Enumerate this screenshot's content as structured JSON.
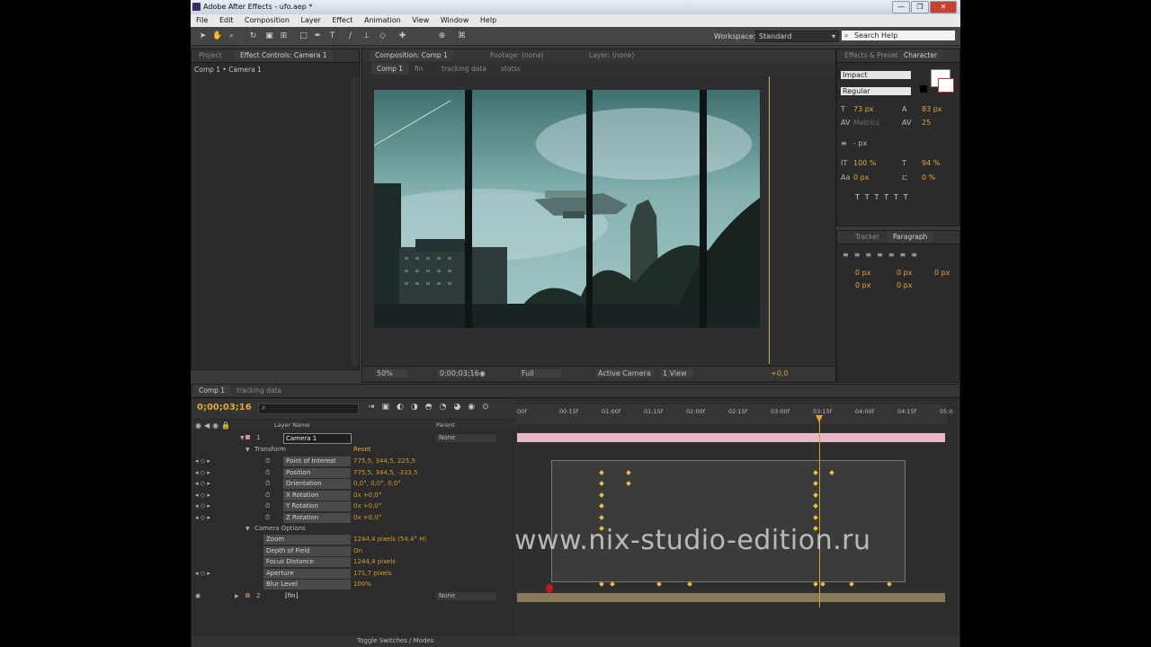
{
  "app": {
    "title": "Adobe After Effects - ufo.aep *",
    "window_buttons": [
      "—",
      "❐",
      "✕"
    ]
  },
  "menu": [
    "File",
    "Edit",
    "Composition",
    "Layer",
    "Effect",
    "Animation",
    "View",
    "Window",
    "Help"
  ],
  "toolbar": {
    "workspace_label": "Workspace:",
    "workspace_value": "Standard",
    "search_placeholder": "Search Help"
  },
  "project_panel": {
    "tabs": [
      "Project",
      "Effect Controls: Camera 1"
    ],
    "crumb": "Comp 1 • Camera 1"
  },
  "comp_panel": {
    "tabs": [
      "Composition: Comp 1",
      "Footage: (none)",
      "Layer: (none)"
    ],
    "subtabs": [
      "Comp 1",
      "fin",
      "tracking data",
      "statsc"
    ],
    "footer": {
      "zoom": "50%",
      "timecode": "0;00;03;16",
      "resolution": "Full",
      "camera": "Active Camera",
      "views": "1 View",
      "exposure": "+0,0"
    }
  },
  "effects_panel": {
    "tabs": [
      "Effects & Presets",
      "Character"
    ],
    "font": "Impact",
    "style": "Regular",
    "size": "73 px",
    "leading": "83 px",
    "kerning": "Metrics",
    "tracking": "25",
    "stroke": "- px",
    "vscale": "100 %",
    "hscale": "94 %",
    "baseline": "0 px",
    "tsume": "0 %"
  },
  "paragraph_panel": {
    "tabs": [
      "Tracker",
      "Paragraph"
    ],
    "fields": [
      "0 px",
      "0 px",
      "0 px",
      "0 px",
      "0 px"
    ]
  },
  "timeline": {
    "tabs": [
      "Comp 1",
      "tracking data"
    ],
    "current_time": "0;00;03;16",
    "ruler": [
      "00f",
      "00:15f",
      "01:00f",
      "01:15f",
      "02:00f",
      "02:15f",
      "03:00f",
      "03:15f",
      "04:00f",
      "04:15f",
      "05:0"
    ],
    "columns": {
      "layer_name": "Layer Name",
      "parent": "Parent"
    },
    "layers": [
      {
        "num": "1",
        "name": "Camera 1",
        "parent": "None"
      },
      {
        "num": "2",
        "name": "[fin]",
        "parent": "None"
      }
    ],
    "transform": {
      "label": "Transform",
      "reset": "Reset"
    },
    "properties": [
      {
        "name": "Point of Interest",
        "value": "775,5, 344,5, 225,5"
      },
      {
        "name": "Position",
        "value": "775,5, 344,5, -333,5"
      },
      {
        "name": "Orientation",
        "value": "0,0°, 0,0°, 0,0°"
      },
      {
        "name": "X Rotation",
        "value": "0x +0,0°"
      },
      {
        "name": "Y Rotation",
        "value": "0x +0,0°"
      },
      {
        "name": "Z Rotation",
        "value": "0x +0,0°"
      }
    ],
    "camera_options": {
      "label": "Camera Options"
    },
    "cam_props": [
      {
        "name": "Zoom",
        "value": "1244,4 pixels (54,4° H)"
      },
      {
        "name": "Depth of Field",
        "value": "On"
      },
      {
        "name": "Focus Distance",
        "value": "1244,4 pixels"
      },
      {
        "name": "Aperture",
        "value": "171,7 pixels"
      },
      {
        "name": "Blur Level",
        "value": "100%"
      }
    ],
    "toggle": "Toggle Switches / Modes"
  },
  "watermark": "www.nix-studio-edition.ru",
  "colors": {
    "accent": "#e0a93a",
    "camera_bar": "#e7b7c3",
    "footage_bar": "#8a7a5a",
    "panel": "#2b2b2b"
  }
}
